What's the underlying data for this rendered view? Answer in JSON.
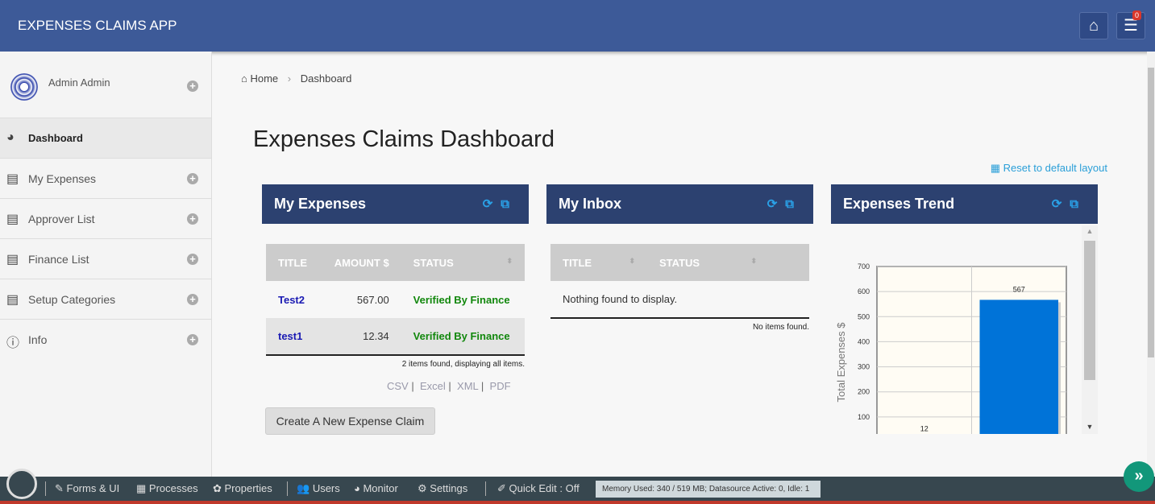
{
  "header": {
    "title": "EXPENSES CLAIMS APP",
    "notification_count": "0"
  },
  "sidebar": {
    "user": "Admin Admin",
    "items": [
      {
        "label": "Dashboard"
      },
      {
        "label": "My Expenses"
      },
      {
        "label": "Approver List"
      },
      {
        "label": "Finance List"
      },
      {
        "label": "Setup Categories"
      },
      {
        "label": "Info"
      }
    ]
  },
  "breadcrumb": {
    "home": "Home",
    "sep": "›",
    "current": "Dashboard"
  },
  "page_title": "Expenses Claims Dashboard",
  "reset_label": "Reset to default layout",
  "my_expenses": {
    "title": "My Expenses",
    "columns": [
      "TITLE",
      "AMOUNT $",
      "STATUS"
    ],
    "rows": [
      {
        "title": "Test2",
        "amount": "567.00",
        "status": "Verified By Finance"
      },
      {
        "title": "test1",
        "amount": "12.34",
        "status": "Verified By Finance"
      }
    ],
    "summary": "2 items found, displaying all items.",
    "exports": [
      "CSV",
      "Excel",
      "XML",
      "PDF"
    ],
    "create_button": "Create A New Expense Claim"
  },
  "inbox": {
    "title": "My Inbox",
    "columns": [
      "TITLE",
      "STATUS"
    ],
    "empty": "Nothing found to display.",
    "summary": "No items found."
  },
  "trend": {
    "title": "Expenses Trend"
  },
  "chart_data": {
    "type": "bar",
    "values": [
      12,
      567
    ],
    "data_labels": [
      "12",
      "567"
    ],
    "ylabel": "Total Expenses $",
    "ylim": [
      0,
      700
    ],
    "yticks": [
      "100",
      "200",
      "300",
      "400",
      "500",
      "600",
      "700"
    ],
    "grid": true,
    "color": "#0073d8"
  },
  "footer": {
    "items": [
      "Forms & UI",
      "Processes",
      "Properties",
      "Users",
      "Monitor",
      "Settings",
      "Quick Edit : Off"
    ],
    "memory": "Memory Used: 340 / 519 MB; Datasource Active: 0, Idle: 1"
  }
}
